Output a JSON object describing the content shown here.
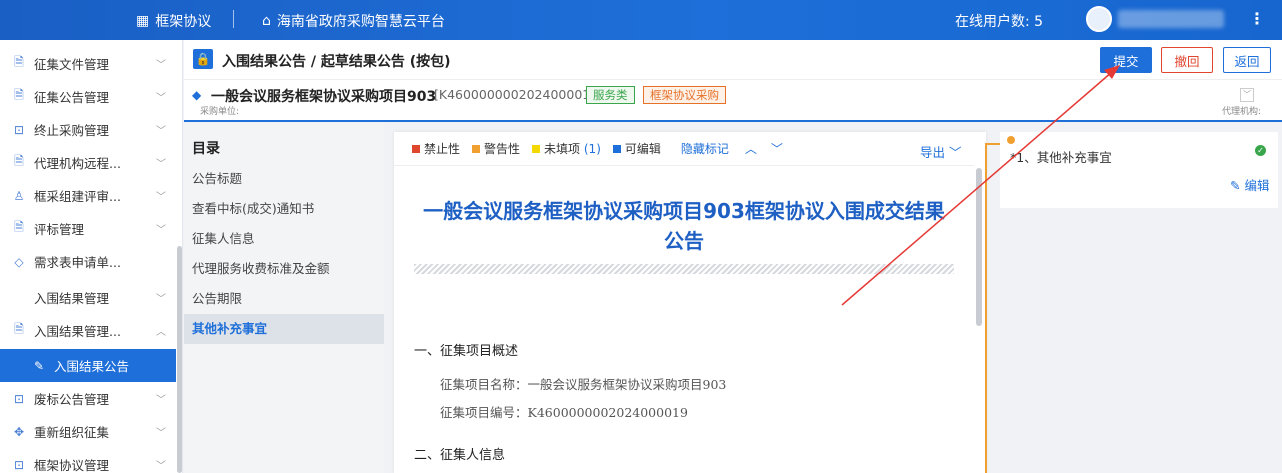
{
  "header": {
    "brand_label": "框架协议",
    "platform_label": "海南省政府采购智慧云平台",
    "online_users": "在线用户数: 5"
  },
  "sidebar": {
    "items": [
      {
        "label": "征集文件管理",
        "icon": "file-doc-icon"
      },
      {
        "label": "征集公告管理",
        "icon": "file-announce-icon"
      },
      {
        "label": "终止采购管理",
        "icon": "stop-icon"
      },
      {
        "label": "代理机构远程...",
        "icon": "agency-icon"
      },
      {
        "label": "框采组建评审...",
        "icon": "review-team-icon"
      },
      {
        "label": "评标管理",
        "icon": "evaluate-icon"
      },
      {
        "label": "需求表申请单...",
        "icon": "diamond-icon"
      },
      {
        "label": "入围结果管理"
      },
      {
        "label": "入围结果管理...",
        "icon": "result-icon"
      },
      {
        "label": "入围结果公告",
        "icon": "edit-doc-icon"
      },
      {
        "label": "废标公告管理",
        "icon": "void-icon"
      },
      {
        "label": "重新组织征集",
        "icon": "grid-icon"
      },
      {
        "label": "框架协议管理",
        "icon": "agreement-icon"
      }
    ]
  },
  "page": {
    "title": "入围结果公告 / 起草结果公告 (按包)",
    "submit": "提交",
    "revoke": "撤回",
    "back": "返回"
  },
  "project": {
    "title": "一般会议服务框架协议采购项目903",
    "code": "[K4600000002024000019]",
    "tag_service": "服务类",
    "tag_procurement": "框架协议采购",
    "unit_label": "采购单位:",
    "agency_label": "代理机构:"
  },
  "toc": {
    "title": "目录",
    "items": [
      "公告标题",
      "查看中标(成交)通知书",
      "征集人信息",
      "代理服务收费标准及金额",
      "公告期限",
      "其他补充事宜"
    ]
  },
  "legend": {
    "forbidden": "禁止性",
    "warning": "警告性",
    "unfilled": "未填项",
    "unfilled_count": "(1)",
    "editable": "可编辑",
    "hide_marks": "隐藏标记",
    "export": "导出",
    "colors": {
      "forbidden": "#e0452e",
      "warning": "#f0a030",
      "unfilled": "#f5d800",
      "editable": "#1e6fd9"
    }
  },
  "document": {
    "heading": "一般会议服务框架协议采购项目903框架协议入围成交结果公告",
    "section1": "一、征集项目概述",
    "project_name_line": "征集项目名称：一般会议服务框架协议采购项目903",
    "project_code_line": "征集项目编号：K4600000002024000019",
    "section2": "二、征集人信息"
  },
  "right_panel": {
    "item": "*1、其他补充事宜",
    "edit": "编辑"
  }
}
